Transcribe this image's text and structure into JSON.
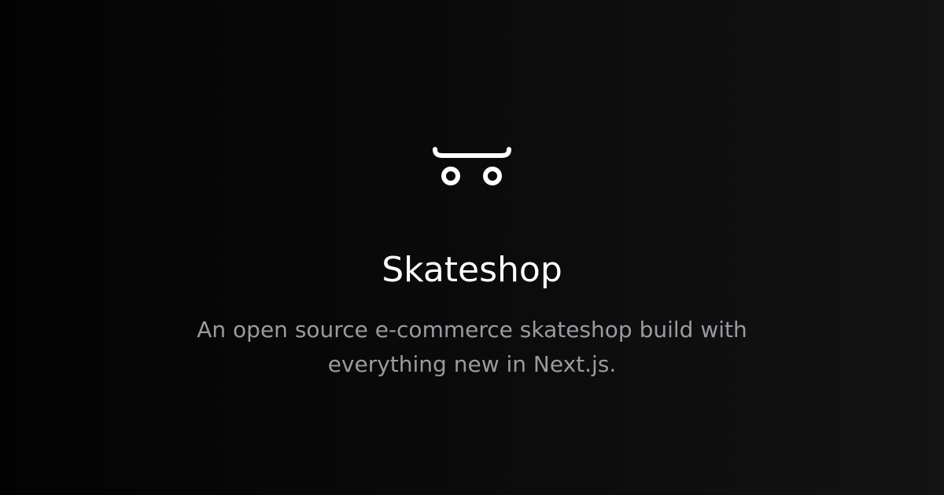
{
  "logo": {
    "icon": "skateboard-icon",
    "color": "#ffffff"
  },
  "title": "Skateshop",
  "description": "An open source e-commerce skateshop build with everything new in Next.js.",
  "colors": {
    "background_dark": "#030303",
    "background_light": "#131313",
    "title": "#ffffff",
    "description": "#9a9aa2"
  }
}
